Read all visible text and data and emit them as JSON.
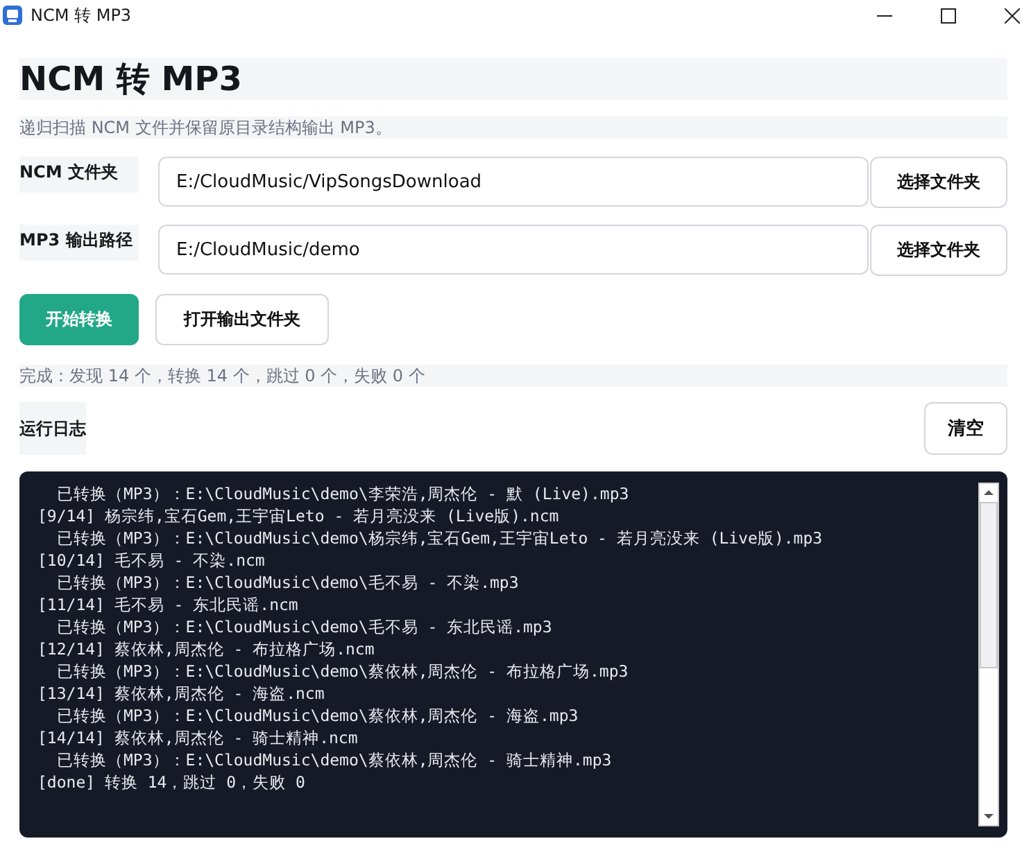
{
  "window": {
    "title": "NCM 转 MP3"
  },
  "heading": "NCM 转 MP3",
  "subtitle": "递归扫描 NCM 文件并保留原目录结构输出 MP3。",
  "fields": [
    {
      "label": "NCM 文件夹",
      "value": "E:/CloudMusic/VipSongsDownload",
      "button": "选择文件夹"
    },
    {
      "label": "MP3 输出路径",
      "value": "E:/CloudMusic/demo",
      "button": "选择文件夹"
    }
  ],
  "actions": [
    {
      "label": "开始转换",
      "kind": "primary"
    },
    {
      "label": "打开输出文件夹",
      "kind": "secondary"
    }
  ],
  "status": "完成：发现 14 个，转换 14 个，跳过 0 个，失败 0 个",
  "log": {
    "title": "运行日志",
    "clear_button": "清空",
    "lines": [
      {
        "kind": "result",
        "text": "已转换（MP3）：E:\\CloudMusic\\demo\\李荣浩,周杰伦 - 默 (Live).mp3"
      },
      {
        "kind": "entry",
        "text": "[9/14] 杨宗纬,宝石Gem,王宇宙Leto - 若月亮没来 (Live版).ncm"
      },
      {
        "kind": "result",
        "text": "已转换（MP3）：E:\\CloudMusic\\demo\\杨宗纬,宝石Gem,王宇宙Leto - 若月亮没来 (Live版).mp3"
      },
      {
        "kind": "entry",
        "text": "[10/14] 毛不易 - 不染.ncm"
      },
      {
        "kind": "result",
        "text": "已转换（MP3）：E:\\CloudMusic\\demo\\毛不易 - 不染.mp3"
      },
      {
        "kind": "entry",
        "text": "[11/14] 毛不易 - 东北民谣.ncm"
      },
      {
        "kind": "result",
        "text": "已转换（MP3）：E:\\CloudMusic\\demo\\毛不易 - 东北民谣.mp3"
      },
      {
        "kind": "entry",
        "text": "[12/14] 蔡依林,周杰伦 - 布拉格广场.ncm"
      },
      {
        "kind": "result",
        "text": "已转换（MP3）：E:\\CloudMusic\\demo\\蔡依林,周杰伦 - 布拉格广场.mp3"
      },
      {
        "kind": "entry",
        "text": "[13/14] 蔡依林,周杰伦 - 海盗.ncm"
      },
      {
        "kind": "result",
        "text": "已转换（MP3）：E:\\CloudMusic\\demo\\蔡依林,周杰伦 - 海盗.mp3"
      },
      {
        "kind": "entry",
        "text": "[14/14] 蔡依林,周杰伦 - 骑士精神.ncm"
      },
      {
        "kind": "result",
        "text": "已转换（MP3）：E:\\CloudMusic\\demo\\蔡依林,周杰伦 - 骑士精神.mp3"
      },
      {
        "kind": "entry",
        "text": "[done] 转换 14，跳过 0，失败 0"
      }
    ]
  }
}
